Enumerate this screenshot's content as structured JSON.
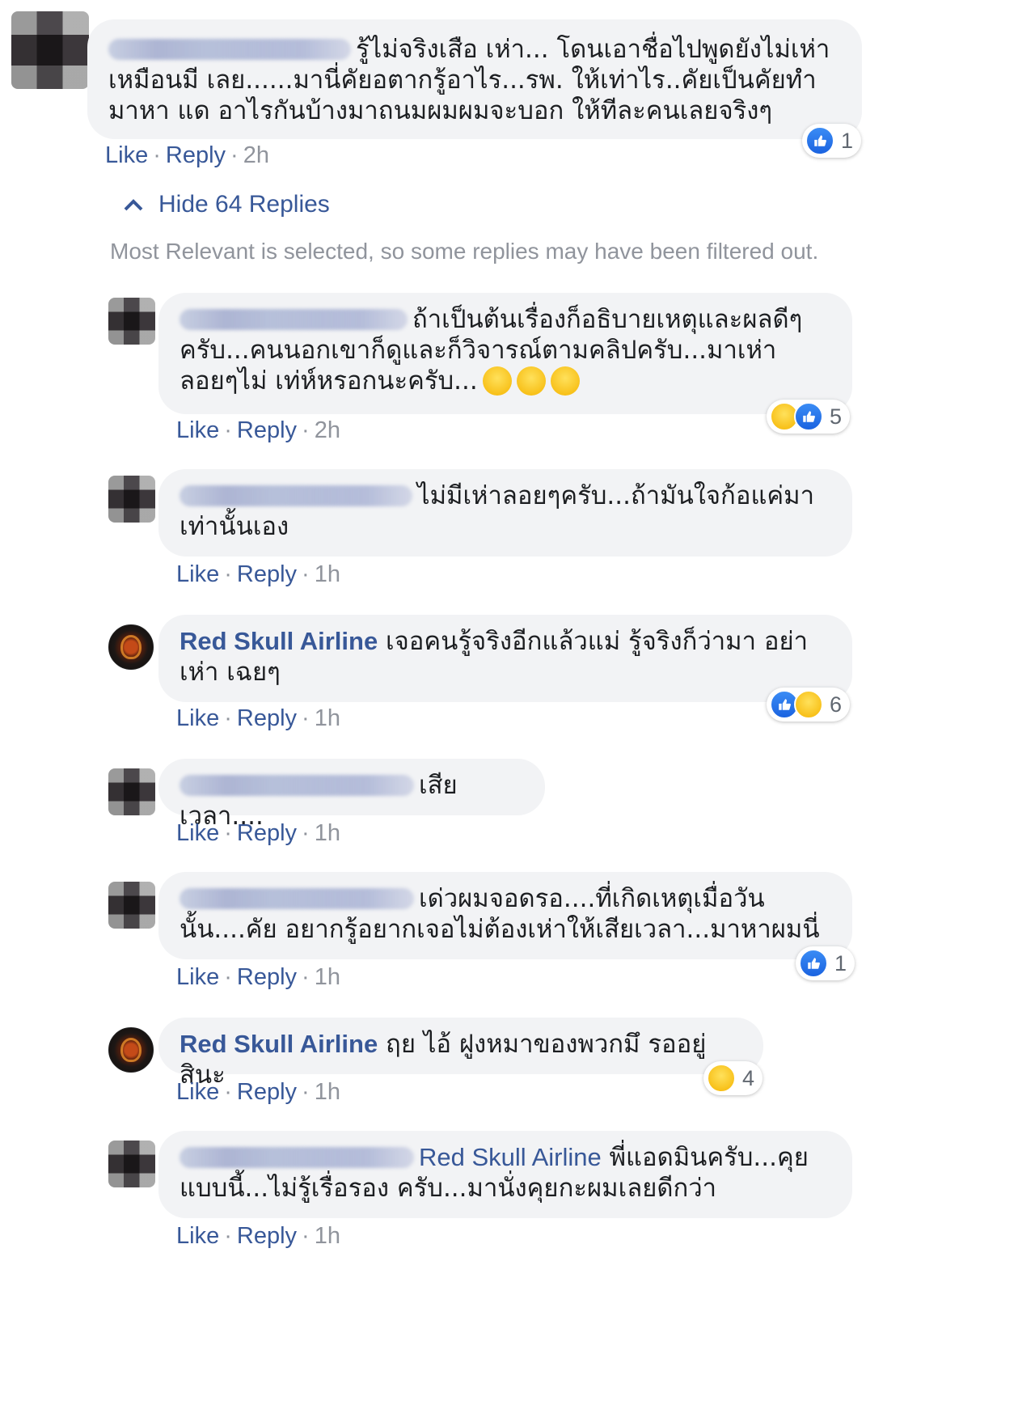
{
  "main_comment": {
    "text": "รู้ไม่จริงเสือ เห่า... โดนเอาชื่อไปพูดยังไม่เห่า เหมือนมี เลย......มานี่คัยอตากรู้อาไร...รพ. ให้เท่าไร..คัยเป็นคัยทำมาหา แด อาไรกันบ้างมาถนมผมผมจะบอก ให้ทีละคนเลยจริงๆ",
    "reaction_count": "1",
    "like": "Like",
    "reply": "Reply",
    "time": "2h"
  },
  "hide_replies": "Hide 64 Replies",
  "filter_note": "Most Relevant is selected, so some replies may have been filtered out.",
  "replies": [
    {
      "author": "",
      "text": "ถ้าเป็นต้นเรื่องก็อธิบายเหตุและผลดีๆ ครับ...คนนอกเขาก็ดูและก็วิจารณ์ตามคลิปครับ...มาเห่าลอยๆไม่ เท่ห์หรอกนะครับ...",
      "reaction_count": "5",
      "like": "Like",
      "reply": "Reply",
      "time": "2h"
    },
    {
      "author": "",
      "text": "ไม่มีเห่าลอยๆครับ...ถ้ามันใจก้อแค่มา เท่านั้นเอง",
      "like": "Like",
      "reply": "Reply",
      "time": "1h"
    },
    {
      "author": "Red Skull Airline",
      "text": "เจอคนรู้จริงอีกแล้วแม่ รู้จริงก็ว่ามา อย่าเห่า เฉยๆ",
      "reaction_count": "6",
      "like": "Like",
      "reply": "Reply",
      "time": "1h"
    },
    {
      "author": "",
      "text": "เสียเวลา....",
      "like": "Like",
      "reply": "Reply",
      "time": "1h"
    },
    {
      "author": "",
      "text": "เด่วผมจอดรอ....ที่เกิดเหตุเมื่อวันนั้น....คัย อยากรู้อยากเจอไม่ต้องเห่าให้เสียเวลา...มาหาผมนี่",
      "reaction_count": "1",
      "like": "Like",
      "reply": "Reply",
      "time": "1h"
    },
    {
      "author": "Red Skull Airline",
      "text": "ฤย ไอ้ ฝูงหมาของพวกมึ รออยู่สินะ",
      "reaction_count": "4",
      "like": "Like",
      "reply": "Reply",
      "time": "1h"
    },
    {
      "author": "",
      "mention": "Red Skull Airline",
      "text": "พี่แอดมินครับ...คุย แบบนี้...ไม่รู้เรื่อรอง ครับ...มานั่งคุยกะผมเลยดีกว่า",
      "like": "Like",
      "reply": "Reply",
      "time": "1h"
    }
  ],
  "icons": {
    "like": "like-icon",
    "haha": "haha-icon",
    "chevron": "chevron-up-icon"
  },
  "colors": {
    "link": "#385898",
    "meta": "#90949c",
    "bubble": "#f2f3f5",
    "like_blue": "#1a63e0",
    "haha_yellow": "#f5b400"
  }
}
